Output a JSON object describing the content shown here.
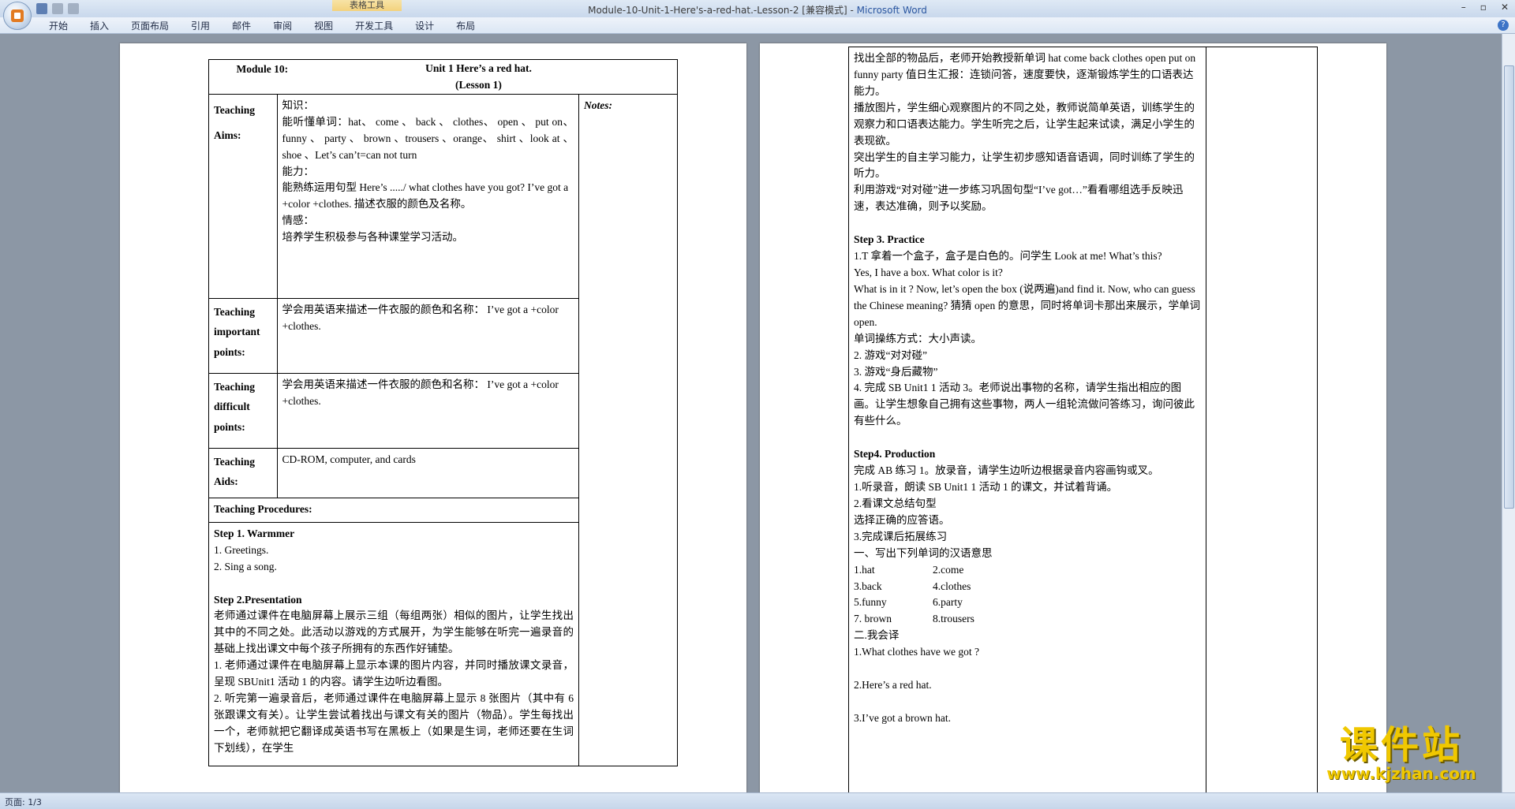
{
  "window": {
    "title_prefix": "Module-10-Unit-1-Here's-a-red-hat.-Lesson-2 [兼容模式] - ",
    "title_app": "Microsoft Word",
    "context_tools": "表格工具",
    "minimize": "–",
    "maximize": "▫",
    "close": "✕"
  },
  "ribbon": {
    "tabs": [
      "开始",
      "插入",
      "页面布局",
      "引用",
      "邮件",
      "审阅",
      "视图",
      "开发工具",
      "设计",
      "布局"
    ],
    "help": "?"
  },
  "status": {
    "page": "页面: 1/3"
  },
  "watermark": {
    "cn": "课件站",
    "url": "www.kjzhan.com"
  },
  "page1": {
    "header_module": "Module 10:",
    "header_unit": "Unit 1    Here’s a red hat.",
    "header_lesson": "(Lesson 1)",
    "notes_label": "Notes:",
    "rows": [
      {
        "label": "Teaching Aims:",
        "lines": [
          "知识：",
          "能听懂单词：hat、  come 、 back 、 clothes、 open 、 put on、  funny 、 party 、 brown 、trousers 、orange、 shirt 、look at 、shoe 、Let’s can’t=can not turn",
          "能力：",
          "能熟练运用句型 Here’s ...../ what clothes have you got?  I’ve got a +color +clothes.  描述衣服的颜色及名称。",
          "情感：",
          "培养学生积极参与各种课堂学习活动。"
        ]
      },
      {
        "label": "Teaching important points:",
        "lines": [
          "学会用英语来描述一件衣服的颜色和名称： I’ve got a +color +clothes."
        ]
      },
      {
        "label": "Teaching difficult points:",
        "lines": [
          "学会用英语来描述一件衣服的颜色和名称： I’ve got a +color +clothes."
        ]
      },
      {
        "label": "Teaching Aids:",
        "lines": [
          "CD-ROM, computer, and cards"
        ]
      }
    ],
    "procedures_label": "Teaching Procedures:",
    "step1_title": "Step 1. Warmmer",
    "step1_items": [
      "1.   Greetings.",
      "2.   Sing a song."
    ],
    "step2_title": "Step 2.Presentation",
    "step2_lines": [
      "老师通过课件在电脑屏幕上展示三组（每组两张）相似的图片，让学生找出其中的不同之处。此活动以游戏的方式展开，为学生能够在听完一遍录音的基础上找出课文中每个孩子所拥有的东西作好铺垫。",
      "1. 老师通过课件在电脑屏幕上显示本课的图片内容，并同时播放课文录音，呈现 SBUnit1 活动 1 的内容。请学生边听边看图。",
      "2. 听完第一遍录音后，老师通过课件在电脑屏幕上显示 8 张图片（其中有 6 张跟课文有关）。让学生尝试着找出与课文有关的图片（物品）。学生每找出一个，老师就把它翻译成英语书写在黑板上（如果是生词，老师还要在生词下划线），在学生"
    ]
  },
  "page2": {
    "top_lines": [
      "找出全部的物品后，老师开始教授新单词 hat come back clothes open put on funny party   值日生汇报：连锁问答，速度要快，逐渐锻炼学生的口语表达能力。",
      "播放图片，学生细心观察图片的不同之处，教师说简单英语，训练学生的观察力和口语表达能力。学生听完之后，让学生起来试读，满足小学生的表现欲。",
      "突出学生的自主学习能力，让学生初步感知语音语调，同时训练了学生的听力。",
      "利用游戏“对对碰”进一步练习巩固句型“I’ve got…”看看哪组选手反映迅速，表达准确，则予以奖励。"
    ],
    "step3_title": "Step 3. Practice",
    "step3_lines": [
      "1.T 拿着一个盒子，盒子是白色的。问学生 Look at me! What’s this?",
      "Yes, I have a box. What color is it?",
      "What is in it ? Now, let’s open the box (说两遍)and find it. Now, who can guess the Chinese meaning?  猜猜 open 的意思，同时将单词卡那出来展示，学单词 open.",
      "单词操练方式：大小声读。",
      "2. 游戏“对对碰”",
      "3. 游戏“身后藏物”",
      "4. 完成 SB Unit1 1 活动 3。老师说出事物的名称，请学生指出相应的图画。让学生想象自己拥有这些事物，两人一组轮流做问答练习，询问彼此有些什么。"
    ],
    "step4_title": "Step4. Production",
    "step4_lines": [
      "完成 AB 练习 1。放录音，请学生边听边根据录音内容画钩或叉。",
      "1.听录音，朗读 SB Unit1 1 活动 1 的课文，并试着背诵。",
      "2.看课文总结句型",
      "选择正确的应答语。",
      "3.完成课后拓展练习",
      "一、写出下列单词的汉语意思"
    ],
    "vocab": [
      [
        "1.hat",
        "2.come"
      ],
      [
        "3.back",
        "4.clothes"
      ],
      [
        "5.funny",
        "6.party"
      ],
      [
        "7. brown",
        "8.trousers"
      ]
    ],
    "part2_title": "二.我会译",
    "translate": [
      "1.What clothes have we got ?",
      "2.Here’s a red hat.",
      "3.I’ve got a brown hat."
    ]
  }
}
